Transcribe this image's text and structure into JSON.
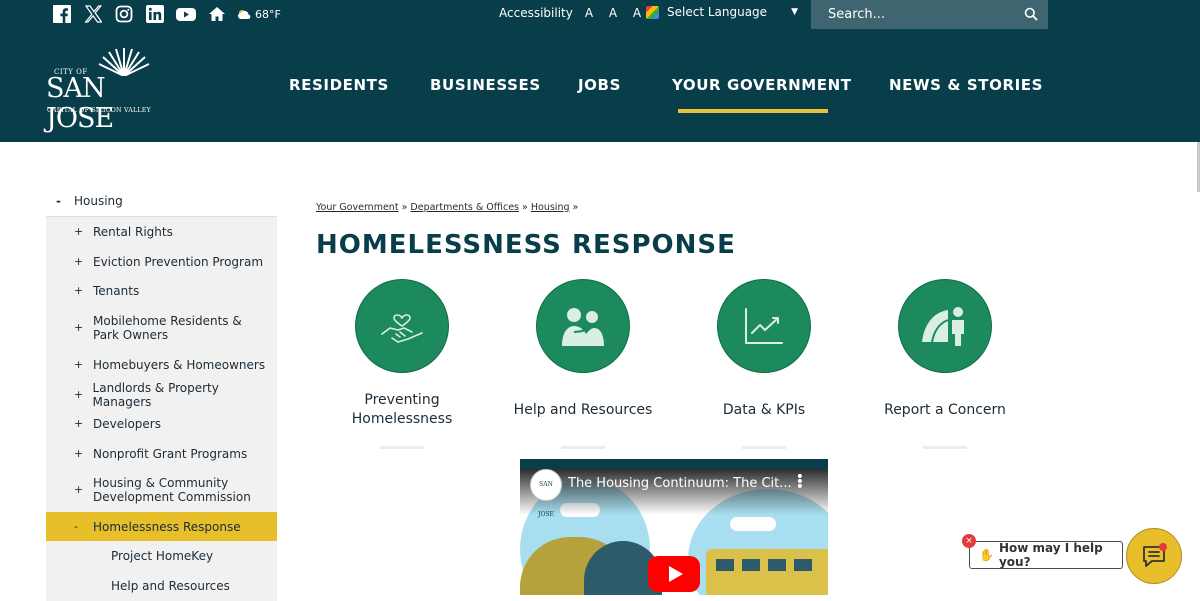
{
  "topbar": {
    "social": [
      "facebook-icon",
      "x-icon",
      "instagram-icon",
      "linkedin-icon",
      "youtube-icon",
      "nextdoor-icon"
    ],
    "weather": {
      "icon": "partly-cloudy-icon",
      "temp": "68°F"
    },
    "accessibility_label": "Accessibility",
    "text_sizes": "A A A",
    "language_label": "Select Language",
    "search_placeholder": "Search..."
  },
  "logo": {
    "city_of": "CITY OF",
    "name": "SAN JOSE",
    "tagline": "CAPITAL OF SILICON VALLEY"
  },
  "nav": {
    "items": [
      {
        "label": "RESIDENTS"
      },
      {
        "label": "BUSINESSES"
      },
      {
        "label": "JOBS"
      },
      {
        "label": "YOUR GOVERNMENT"
      },
      {
        "label": "NEWS & STORIES"
      }
    ],
    "active": "YOUR GOVERNMENT"
  },
  "sidebar": {
    "top": {
      "sign": "-",
      "label": "Housing"
    },
    "items": [
      {
        "sign": "+",
        "label": "Rental Rights"
      },
      {
        "sign": "+",
        "label": "Eviction Prevention Program"
      },
      {
        "sign": "+",
        "label": "Tenants"
      },
      {
        "sign": "+",
        "label": "Mobilehome Residents & Park Owners"
      },
      {
        "sign": "+",
        "label": "Homebuyers & Homeowners"
      },
      {
        "sign": "+",
        "label": "Landlords & Property Managers"
      },
      {
        "sign": "+",
        "label": "Developers"
      },
      {
        "sign": "+",
        "label": "Nonprofit Grant Programs"
      },
      {
        "sign": "+",
        "label": "Housing & Community Development Commission"
      },
      {
        "sign": "-",
        "label": "Homelessness Response"
      }
    ],
    "subitems": [
      {
        "label": "Project HomeKey"
      },
      {
        "label": "Help and Resources"
      }
    ]
  },
  "breadcrumb": {
    "items": [
      "Your Government",
      "Departments & Offices",
      "Housing"
    ],
    "separator": "»"
  },
  "page_title": "HOMELESSNESS RESPONSE",
  "cards": [
    {
      "label": "Preventing Homelessness",
      "icon": "heart-handshake-icon"
    },
    {
      "label": "Help and Resources",
      "icon": "people-embrace-icon"
    },
    {
      "label": "Data & KPIs",
      "icon": "line-chart-icon"
    },
    {
      "label": "Report a Concern",
      "icon": "person-tent-icon"
    }
  ],
  "video": {
    "title": "The Housing Continuum: The Cit...",
    "channel_badge": "SAN JOSE"
  },
  "chat": {
    "prompt": "How may I help you?",
    "close": "×"
  },
  "colors": {
    "header_bg": "#083d4a",
    "accent_yellow": "#e7bf2b",
    "card_green": "#1c8a5c"
  }
}
